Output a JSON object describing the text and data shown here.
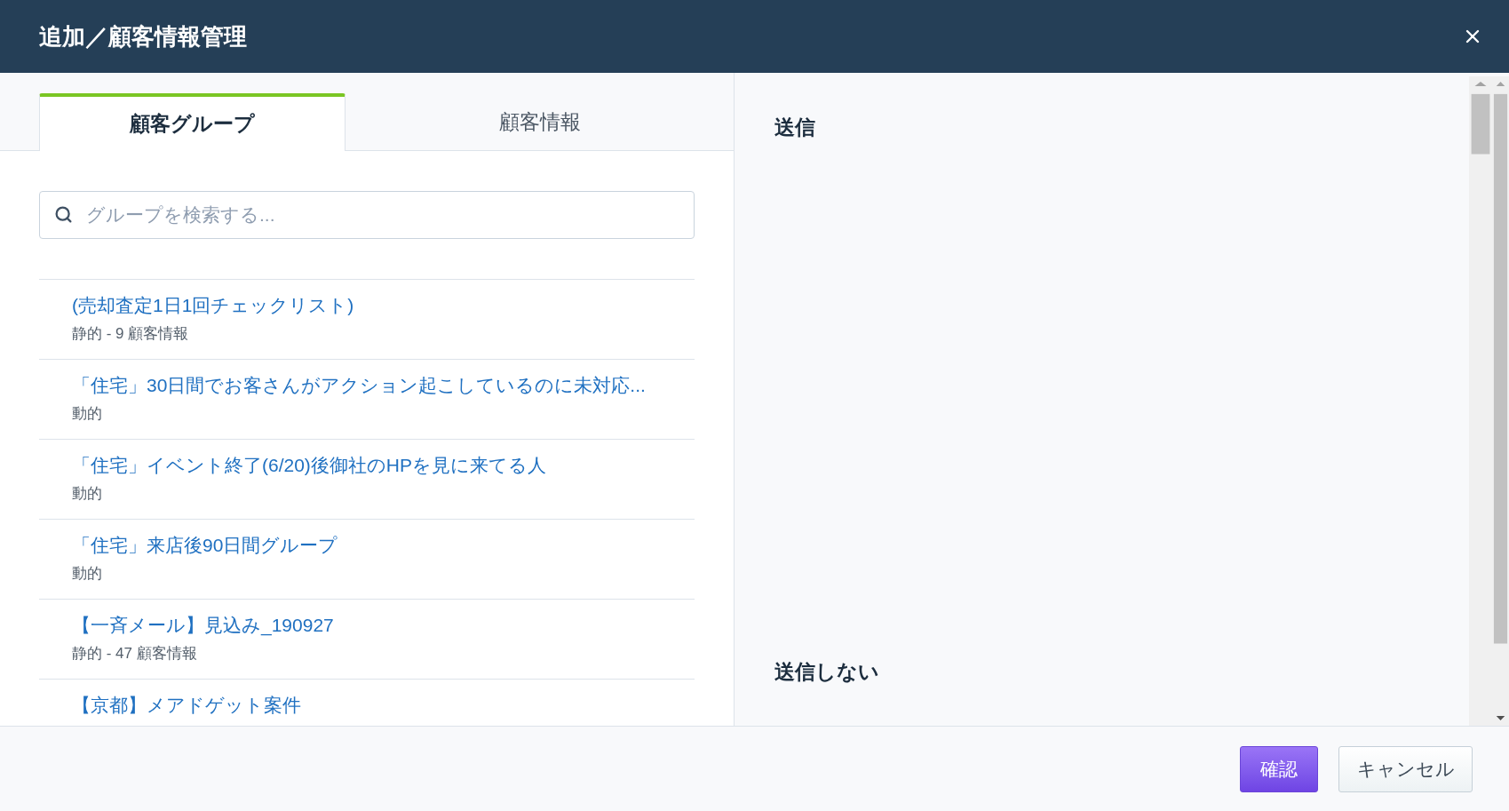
{
  "dialog": {
    "title": "追加／顧客情報管理"
  },
  "tabs": [
    {
      "label": "顧客グループ",
      "selected": true
    },
    {
      "label": "顧客情報",
      "selected": false
    }
  ],
  "search": {
    "placeholder": "グループを検索する..."
  },
  "groups": [
    {
      "name": "(売却査定1日1回チェックリスト)",
      "detail": "静的 - 9 顧客情報"
    },
    {
      "name": "「住宅」30日間でお客さんがアクション起こしているのに未対応...",
      "detail": "動的"
    },
    {
      "name": "「住宅」イベント終了(6/20)後御社のHPを見に来てる人",
      "detail": "動的"
    },
    {
      "name": "「住宅」来店後90日間グループ",
      "detail": "動的"
    },
    {
      "name": "【一斉メール】見込み_190927",
      "detail": "静的 - 47 顧客情報"
    },
    {
      "name": "【京都】メアドゲット案件"
    }
  ],
  "sections": [
    "送信",
    "送信しない"
  ],
  "buttons": [
    {
      "label": "確認",
      "kind": "primary"
    },
    {
      "label": "キャンセル",
      "kind": "secondary"
    }
  ]
}
